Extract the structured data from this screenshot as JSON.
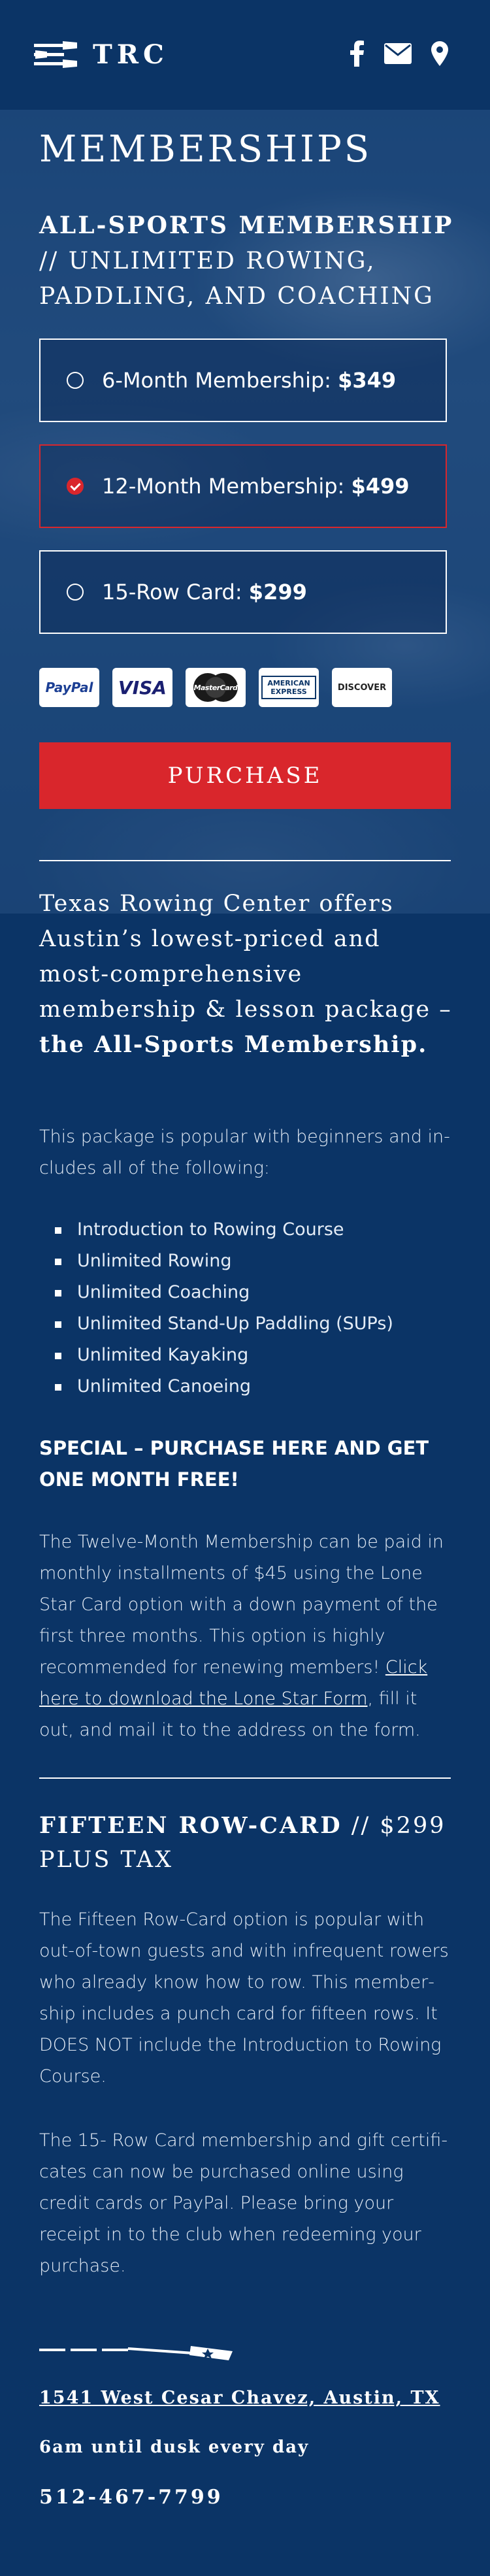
{
  "header": {
    "logo_text": "TRC",
    "icons": [
      "oars-logo-icon",
      "facebook-icon",
      "email-icon",
      "map-pin-icon"
    ]
  },
  "page_title": "MEMBERSHIPS",
  "subtitle": {
    "bold": "ALL-SPORTS MEMBERSHIP",
    "separator": " // ",
    "rest": "UNLIMITED ROWING, PADDLING, AND COACHING"
  },
  "options": [
    {
      "label": "6-Month Membership: ",
      "price": "$349",
      "selected": false
    },
    {
      "label": "12-Month Membership: ",
      "price": "$499",
      "selected": true
    },
    {
      "label": "15-Row Card: ",
      "price": "$299",
      "selected": false
    }
  ],
  "payment_cards": [
    "PayPal",
    "VISA",
    "MasterCard",
    "AMERICAN EXPRESS",
    "DISCOVER"
  ],
  "purchase_label": "PURCHASE",
  "intro": {
    "text": "Texas Rowing Center offers Austin’s lowest-priced and most-comprehensive membership & lesson package –",
    "bold": "the All-Sports Membership."
  },
  "package_text": "This package is popular with beginners and in­cludes all of the following:",
  "package_items": [
    "Introduction to Rowing Course",
    "Unlimited Rowing",
    "Unlimited Coaching",
    "Unlimited Stand-Up Paddling (SUPs)",
    "Unlimited Kayaking",
    "Unlimited Canoeing"
  ],
  "special": "SPECIAL – PURCHASE HERE AND GET ONE MONTH FREE!",
  "twelve_month": {
    "text": "The Twelve-Month Membership can be paid in monthly installments of $45 using the Lone Star Card option with a down payment of the first three months. This option is highly recom­mended for renewing members! ",
    "link": "Click here to download the Lone Star Form",
    "after": ", fill it out, and mail it to the address on the form."
  },
  "fifteen": {
    "title_bold": "FIFTEEN ROW-CARD",
    "title_rest": " // $299 PLUS TAX",
    "para1": "The Fifteen Row-Card option is popular with out-of-town guests and with infrequent rowers who already know how to row. This member­ship includes a punch card for fifteen rows. It DOES NOT include the Introduction to Rowing Course.",
    "para2": "The 15- Row Card membership and gift certifi­cates can now be purchased online using credit cards or PayPal. Please bring your receipt in to the club when redeeming your purchase."
  },
  "footer": {
    "address": "1541 West Cesar Chavez, Austin, TX",
    "hours": "6am until dusk every day",
    "phone": "512-467-7799"
  },
  "colors": {
    "navy": "#0b3466",
    "red": "#d9262c"
  }
}
